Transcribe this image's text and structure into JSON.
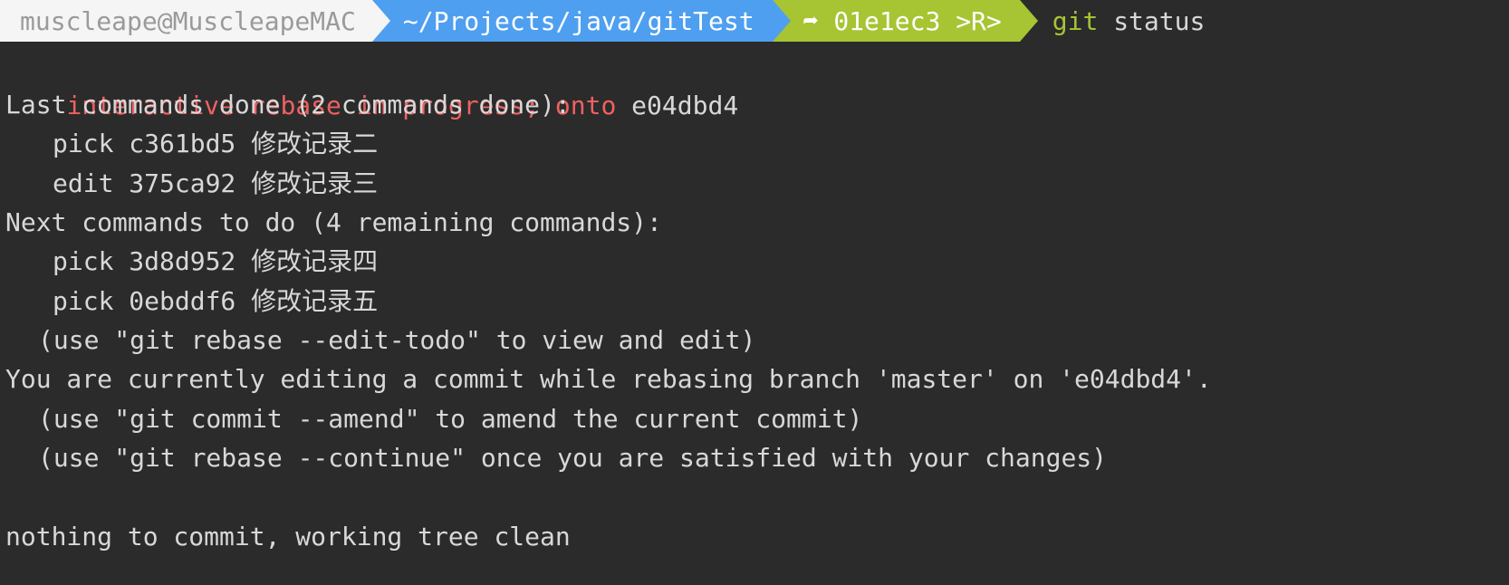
{
  "prompt": {
    "user_host": "muscleape@MuscleapeMAC",
    "path": "~/Projects/java/gitTest",
    "branch_icon": "➦",
    "branch": "01e1ec3 >R>",
    "command_program": "git",
    "command_args": " status"
  },
  "colors": {
    "background": "#2b2b2b",
    "text": "#d8d8d8",
    "error_red": "#f06060",
    "segment_user_bg": "#f5f5f5",
    "segment_path_bg": "#4f9ff0",
    "segment_branch_bg": "#a7c433"
  },
  "output": {
    "rebase_status": "interactive rebase in progress; onto",
    "onto_hash": " e04dbd4",
    "last_done_header": "Last commands done (2 commands done):",
    "last_done": [
      "pick c361bd5 修改记录二",
      "edit 375ca92 修改记录三"
    ],
    "next_header": "Next commands to do (4 remaining commands):",
    "next": [
      "pick 3d8d952 修改记录四",
      "pick 0ebddf6 修改记录五"
    ],
    "hint_edit_todo": "(use \"git rebase --edit-todo\" to view and edit)",
    "editing_line": "You are currently editing a commit while rebasing branch 'master' on 'e04dbd4'.",
    "hint_amend": "(use \"git commit --amend\" to amend the current commit)",
    "hint_continue": "(use \"git rebase --continue\" once you are satisfied with your changes)",
    "clean": "nothing to commit, working tree clean"
  }
}
